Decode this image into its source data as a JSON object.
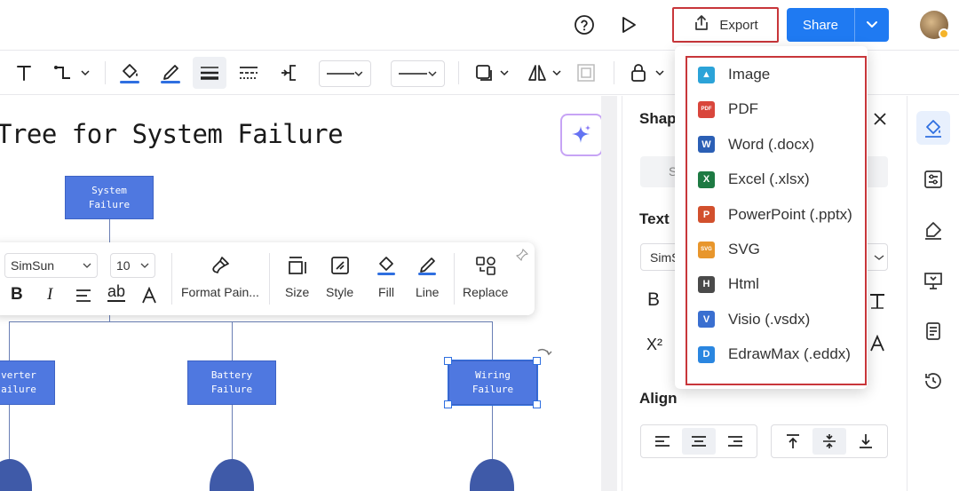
{
  "topbar": {
    "export_label": "Export",
    "share_label": "Share",
    "icons": [
      "help-icon",
      "play-icon",
      "export-icon",
      "chevron-down-icon",
      "avatar"
    ]
  },
  "toolbar": {
    "icons": [
      "text-icon",
      "connector-icon",
      "fill-bucket-icon",
      "pen-icon",
      "line-weight-icon",
      "line-dash-icon",
      "branch-icon",
      "line-style-icon",
      "arrow-style-icon",
      "shadow-icon",
      "flip-icon",
      "group-icon",
      "lock-icon"
    ]
  },
  "canvas": {
    "title": "Tree for System Failure",
    "nodes": {
      "top": "System\nFailure",
      "left": "verter\nailure",
      "middle": "Battery\nFailure",
      "right": "Wiring\nFailure"
    },
    "ai_icon": "sparkle-icon"
  },
  "format_bar": {
    "font": "SimSun",
    "size": "10",
    "text_buttons": [
      "B",
      "I"
    ],
    "ab": "ab",
    "tools": {
      "format_painter": "Format Pain...",
      "size": "Size",
      "style": "Style",
      "fill": "Fill",
      "line": "Line",
      "replace": "Replace"
    }
  },
  "panel": {
    "title": "Shap",
    "text_label": "Text",
    "font_value": "SimS",
    "search_placeholder": "S",
    "bold": "B",
    "superscript": "X²",
    "align_label": "Align"
  },
  "export_menu": {
    "items": [
      {
        "label": "Image",
        "icon": "image-icon",
        "color": "#2ba3d8",
        "glyph": "▲"
      },
      {
        "label": "PDF",
        "icon": "pdf-icon",
        "color": "#d9463c",
        "glyph": "PDF"
      },
      {
        "label": "Word (.docx)",
        "icon": "word-icon",
        "color": "#2b5fb5",
        "glyph": "W"
      },
      {
        "label": "Excel (.xlsx)",
        "icon": "excel-icon",
        "color": "#1e7a43",
        "glyph": "X"
      },
      {
        "label": "PowerPoint (.pptx)",
        "icon": "powerpoint-icon",
        "color": "#d2502d",
        "glyph": "P"
      },
      {
        "label": "SVG",
        "icon": "svg-icon",
        "color": "#e8962c",
        "glyph": "SVG"
      },
      {
        "label": "Html",
        "icon": "html-icon",
        "color": "#4a4a4a",
        "glyph": "H"
      },
      {
        "label": "Visio (.vsdx)",
        "icon": "visio-icon",
        "color": "#3a6fd0",
        "glyph": "V"
      },
      {
        "label": "EdrawMax (.eddx)",
        "icon": "edrawmax-icon",
        "color": "#2a86e0",
        "glyph": "D"
      }
    ]
  },
  "colors": {
    "accent": "#1f7af2",
    "highlight_border": "#c8363a",
    "node_fill": "#4f78e0",
    "gate_fill": "#3f5aa8"
  }
}
